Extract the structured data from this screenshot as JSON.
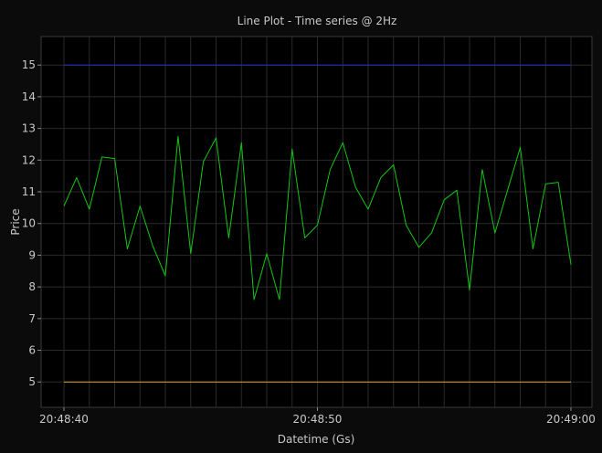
{
  "chart_data": {
    "type": "line",
    "title": "Line Plot - Time series @ 2Hz",
    "xlabel": "Datetime (Gs)",
    "ylabel": "Price",
    "x_ticks": [
      "20:48:40",
      "20:48:50",
      "20:49:00"
    ],
    "y_ticks": [
      5,
      6,
      7,
      8,
      9,
      10,
      11,
      12,
      13,
      14,
      15
    ],
    "ylim": [
      4.2,
      15.9
    ],
    "grid": true,
    "colors": {
      "background": "#0b0b0b",
      "plot_background": "#000000",
      "text": "#c8c8c8",
      "grid": "#2a2a2a",
      "price": "#15c515",
      "upper": "#1f33c8",
      "lower": "#e6a028"
    },
    "series": [
      {
        "values": [
          10.55,
          11.45,
          10.45,
          12.1,
          12.05,
          9.2,
          10.55,
          9.3,
          8.35,
          12.75,
          9.05,
          11.95,
          12.7,
          9.55,
          12.55,
          7.6,
          9.05,
          7.6,
          12.35,
          9.55,
          9.95,
          11.7,
          12.55,
          11.15,
          10.45,
          11.45,
          11.85,
          9.95,
          9.25,
          9.7,
          10.75,
          11.05,
          7.9,
          11.7,
          9.7,
          11.05,
          12.4,
          9.2,
          11.25,
          11.3,
          8.7
        ]
      },
      {
        "values": [
          15,
          15
        ]
      },
      {
        "values": [
          5,
          5
        ]
      }
    ]
  }
}
